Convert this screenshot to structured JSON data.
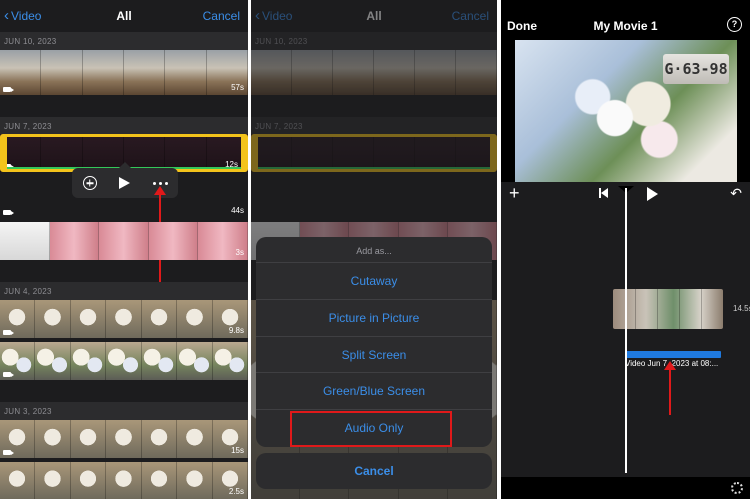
{
  "panel1": {
    "nav": {
      "back_label": "Video",
      "title": "All",
      "cancel_label": "Cancel"
    },
    "sections": [
      {
        "date": "JUN 10, 2023",
        "clips": [
          {
            "duration": "57s"
          }
        ]
      },
      {
        "date": "JUN 7, 2023",
        "clips": [
          {
            "duration": "12s"
          },
          {
            "duration": "44s"
          },
          {
            "duration": "3s"
          }
        ]
      },
      {
        "date": "JUN 4, 2023",
        "clips": [
          {
            "duration": "9.8s"
          },
          {
            "duration": ""
          }
        ]
      },
      {
        "date": "JUN 3, 2023",
        "clips": [
          {
            "duration": "15s"
          },
          {
            "duration": "2.5s"
          }
        ]
      }
    ],
    "action_bar": {
      "add_icon": "plus-circle-icon",
      "play_icon": "play-icon",
      "more_icon": "ellipsis-icon"
    }
  },
  "panel2": {
    "nav": {
      "back_label": "Video",
      "title": "All",
      "cancel_label": "Cancel"
    },
    "dates": [
      "JUN 10, 2023",
      "JUN 7, 2023"
    ],
    "sheet": {
      "header": "Add as...",
      "items": [
        "Cutaway",
        "Picture in Picture",
        "Split Screen",
        "Green/Blue Screen",
        "Audio Only"
      ],
      "highlighted": "Audio Only",
      "cancel_label": "Cancel"
    }
  },
  "panel3": {
    "done_label": "Done",
    "title": "My Movie 1",
    "help_icon": "?",
    "plate_text": "G·63-98",
    "clip_duration": "14.5s",
    "audio_label": "Video Jun 7, 2023 at 08:...",
    "undo_icon": "↶"
  },
  "colors": {
    "accent": "#3b8ee8",
    "highlight": "#f3c31b",
    "annotation": "#e0191a",
    "audio_track": "#1f7ae0"
  }
}
